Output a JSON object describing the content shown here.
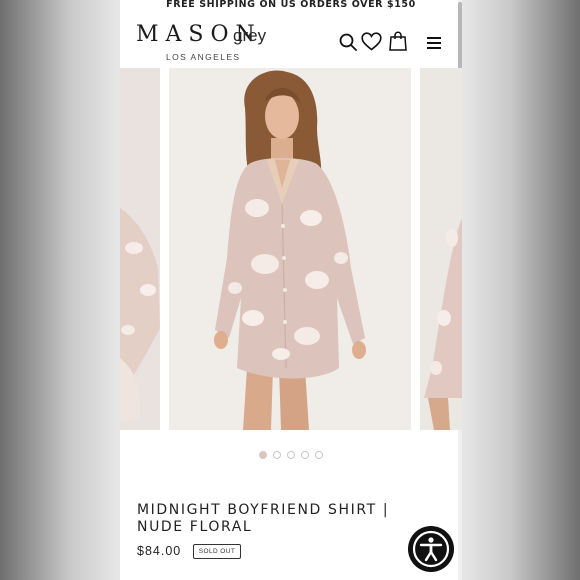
{
  "announcement": "FREE SHIPPING ON US ORDERS OVER $150",
  "brand": {
    "main": "MASON",
    "sub": "grey",
    "city": "LOS ANGELES"
  },
  "header_icons": [
    "search-icon",
    "heart-icon",
    "shopping-bag-icon",
    "menu-icon"
  ],
  "carousel": {
    "slide_count": 5,
    "active_index": 0
  },
  "product": {
    "title_line1": "MIDNIGHT BOYFRIEND SHIRT |",
    "title_line2": "NUDE FLORAL",
    "price": "$84.00",
    "badge": "SOLD OUT"
  },
  "colors": {
    "accent": "#d9c6c0",
    "fabric": "#dcc3bb",
    "text": "#222222"
  }
}
